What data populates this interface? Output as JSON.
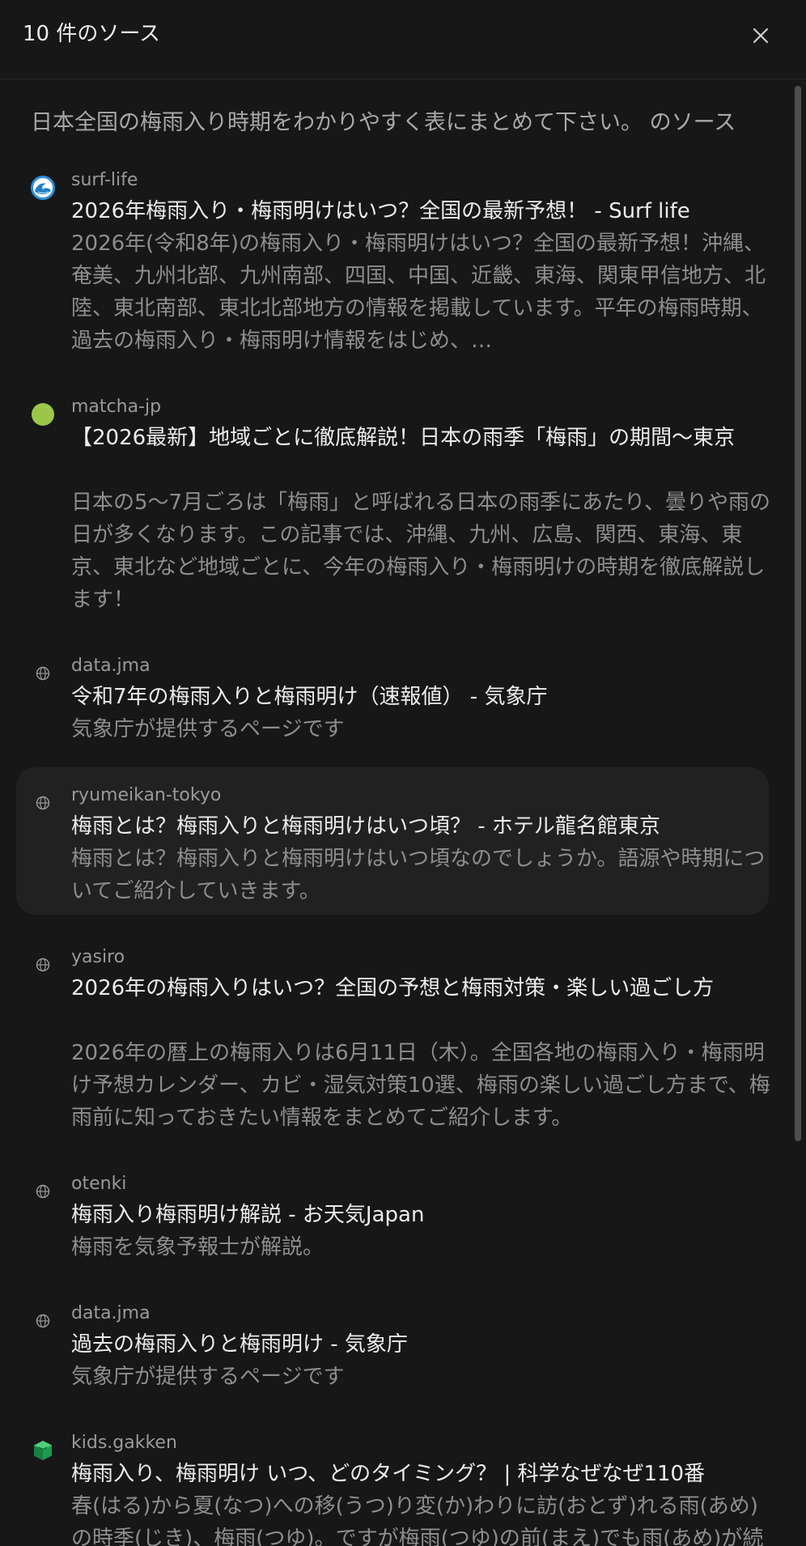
{
  "header": {
    "title": "10 件のソース",
    "close_label": "閉じる"
  },
  "query": "日本全国の梅雨入り時期をわかりやすく表にまとめて下さい。 のソース",
  "sources": [
    {
      "site": "surf-life",
      "icon": "wave-logo-icon",
      "title": "2026年梅雨入り・梅雨明けはいつ？全国の最新予想！ - Surf life",
      "snippet": "2026年(令和8年)の梅雨入り・梅雨明けはいつ？全国の最新予想！沖縄、奄美、九州北部、九州南部、四国、中国、近畿、東海、関東甲信地方、北陸、東北南部、東北北部地方の情報を掲載しています。平年の梅雨時期、過去の梅雨入り・梅雨明け情報をはじめ、…"
    },
    {
      "site": "matcha-jp",
      "icon": "green-circle-logo-icon",
      "title": "【2026最新】地域ごとに徹底解説！日本の雨季「梅雨」の期間〜東京",
      "snippet": "日本の5〜7月ごろは「梅雨」と呼ばれる日本の雨季にあたり、曇りや雨の日が多くなります。この記事では、沖縄、九州、広島、関西、東海、東京、東北など地域ごとに、今年の梅雨入り・梅雨明けの時期を徹底解説します！"
    },
    {
      "site": "data.jma",
      "icon": "globe-icon",
      "title": "令和7年の梅雨入りと梅雨明け（速報値） - 気象庁",
      "snippet": "気象庁が提供するページです"
    },
    {
      "site": "ryumeikan-tokyo",
      "icon": "globe-icon",
      "title": "梅雨とは？梅雨入りと梅雨明けはいつ頃？ - ホテル龍名館東京",
      "snippet": "梅雨とは？梅雨入りと梅雨明けはいつ頃なのでしょうか。語源や時期についてご紹介していきます。"
    },
    {
      "site": "yasiro",
      "icon": "globe-icon",
      "title": "2026年の梅雨入りはいつ？全国の予想と梅雨対策・楽しい過ごし方",
      "snippet": "2026年の暦上の梅雨入りは6月11日（木）。全国各地の梅雨入り・梅雨明け予想カレンダー、カビ・湿気対策10選、梅雨の楽しい過ごし方まで、梅雨前に知っておきたい情報をまとめてご紹介します。"
    },
    {
      "site": "otenki",
      "icon": "globe-icon",
      "title": "梅雨入り梅雨明け解説 - お天気Japan",
      "snippet": "梅雨を気象予報士が解説。"
    },
    {
      "site": "data.jma",
      "icon": "globe-icon",
      "title": "過去の梅雨入りと梅雨明け - 気象庁",
      "snippet": "気象庁が提供するページです"
    },
    {
      "site": "kids.gakken",
      "icon": "green-cube-logo-icon",
      "title": "梅雨入り、梅雨明け いつ、どのタイミング？ | 科学なぜなぜ110番",
      "snippet": "春(はる)から夏(なつ)への移(うつ)り変(か)わりに訪(おとず)れる雨(あめ)の時季(じき)、梅雨(つゆ)。ですが梅雨(つゆ)の前(まえ)でも雨(あめ)が続(つづ)く日(ひ)もあります。"
    }
  ],
  "colors": {
    "background": "#171717",
    "highlight": "#212121",
    "title_text": "#ececec",
    "muted_text": "#8e8e8e"
  }
}
